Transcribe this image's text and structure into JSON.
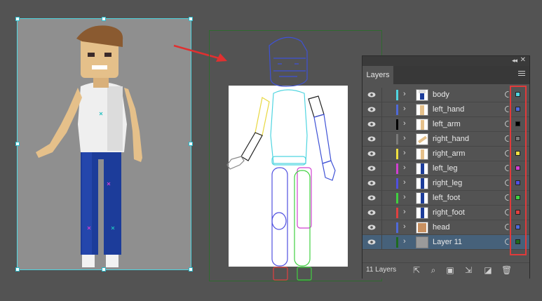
{
  "layers_panel": {
    "tab_label": "Layers",
    "layers_count": "11 Layers",
    "collapse_glyph": "◂◂",
    "close_glyph": "✕",
    "layers": [
      {
        "name": "body",
        "color": "#4fd5e0",
        "thumb": "body"
      },
      {
        "name": "left_hand",
        "color": "#4f6ad8",
        "thumb": "hand"
      },
      {
        "name": "left_arm",
        "color": "#000000",
        "thumb": "arm"
      },
      {
        "name": "right_hand",
        "color": "#7a7a7a",
        "thumb": "hand2"
      },
      {
        "name": "right_arm",
        "color": "#f0e040",
        "thumb": "arm"
      },
      {
        "name": "left_leg",
        "color": "#d040d0",
        "thumb": "leg"
      },
      {
        "name": "right_leg",
        "color": "#5050e0",
        "thumb": "leg"
      },
      {
        "name": "left_foot",
        "color": "#40d040",
        "thumb": "leg"
      },
      {
        "name": "right_foot",
        "color": "#e04040",
        "thumb": "leg"
      },
      {
        "name": "head",
        "color": "#4f6ad8",
        "thumb": "head"
      },
      {
        "name": "Layer 11",
        "color": "#1f6b1f",
        "thumb": "blank",
        "selected": true
      }
    ]
  },
  "icons": {
    "eye": "eye-icon",
    "expand": "chevron-right-icon",
    "footer": [
      "export-icon",
      "search-icon",
      "clipping-mask-icon",
      "sublayer-icon",
      "new-layer-icon",
      "trash-icon"
    ]
  }
}
